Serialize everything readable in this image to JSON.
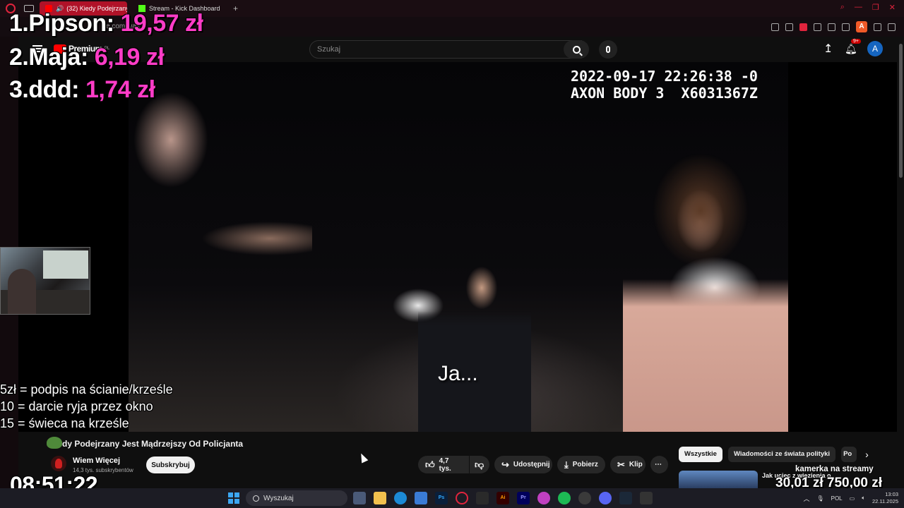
{
  "browser": {
    "tabs": [
      {
        "label": "(32) Kiedy Podejrzany",
        "active": true
      },
      {
        "label": "Stream - Kick Dashboard",
        "active": false
      }
    ],
    "new_tab": "+",
    "url": "e.com/watch",
    "profile_initial": "A",
    "accent": "#e0243d"
  },
  "youtube": {
    "logo": "Premium",
    "logo_region": "PL",
    "search_placeholder": "Szukaj",
    "notifications": "9+",
    "avatar_initial": "A",
    "video": {
      "overlay_line1": "2022-09-17 22:26:38 -0",
      "overlay_line2": "AXON BODY 3  X6031367Z",
      "subtitle": "Ja..."
    },
    "title": "dy Podejrzany Jest Mądrzejszy Od Policjanta",
    "channel": {
      "name": "Wiem Więcej",
      "subs": "14,3 tys. subskrybentów"
    },
    "subscribe": "Subskrybuj",
    "actions": {
      "likes": "4,7 tys.",
      "share": "Udostępnij",
      "download": "Pobierz",
      "clip": "Klip",
      "more": "⋯"
    },
    "chips": [
      "Wszystkie",
      "Wiadomości ze świata polityki",
      "Po"
    ],
    "recommended_title": "Jak uciec z więzienia o"
  },
  "overlay": {
    "donors": [
      {
        "rank": "1.",
        "name": "Pipson:",
        "amount": "19,57 zł"
      },
      {
        "rank": "2.",
        "name": "Maja:",
        "amount": "6,19 zł"
      },
      {
        "rank": "3.",
        "name": "ddd:",
        "amount": "1,74 zł"
      }
    ],
    "rules": [
      "5zł = podpis na ścianie/krześle",
      "10 = darcie ryja przez okno",
      "15 = świeca na krześle"
    ],
    "clock": "08:51:22",
    "goal": {
      "label": "kamerka na streamy",
      "current": "30,01 zł",
      "target": "750,00 zł"
    },
    "amount_color": "#ff3cc7"
  },
  "taskbar": {
    "search_placeholder": "Wyszukaj",
    "lang": "POL",
    "time": "13:03",
    "date": "22.11.2025"
  }
}
